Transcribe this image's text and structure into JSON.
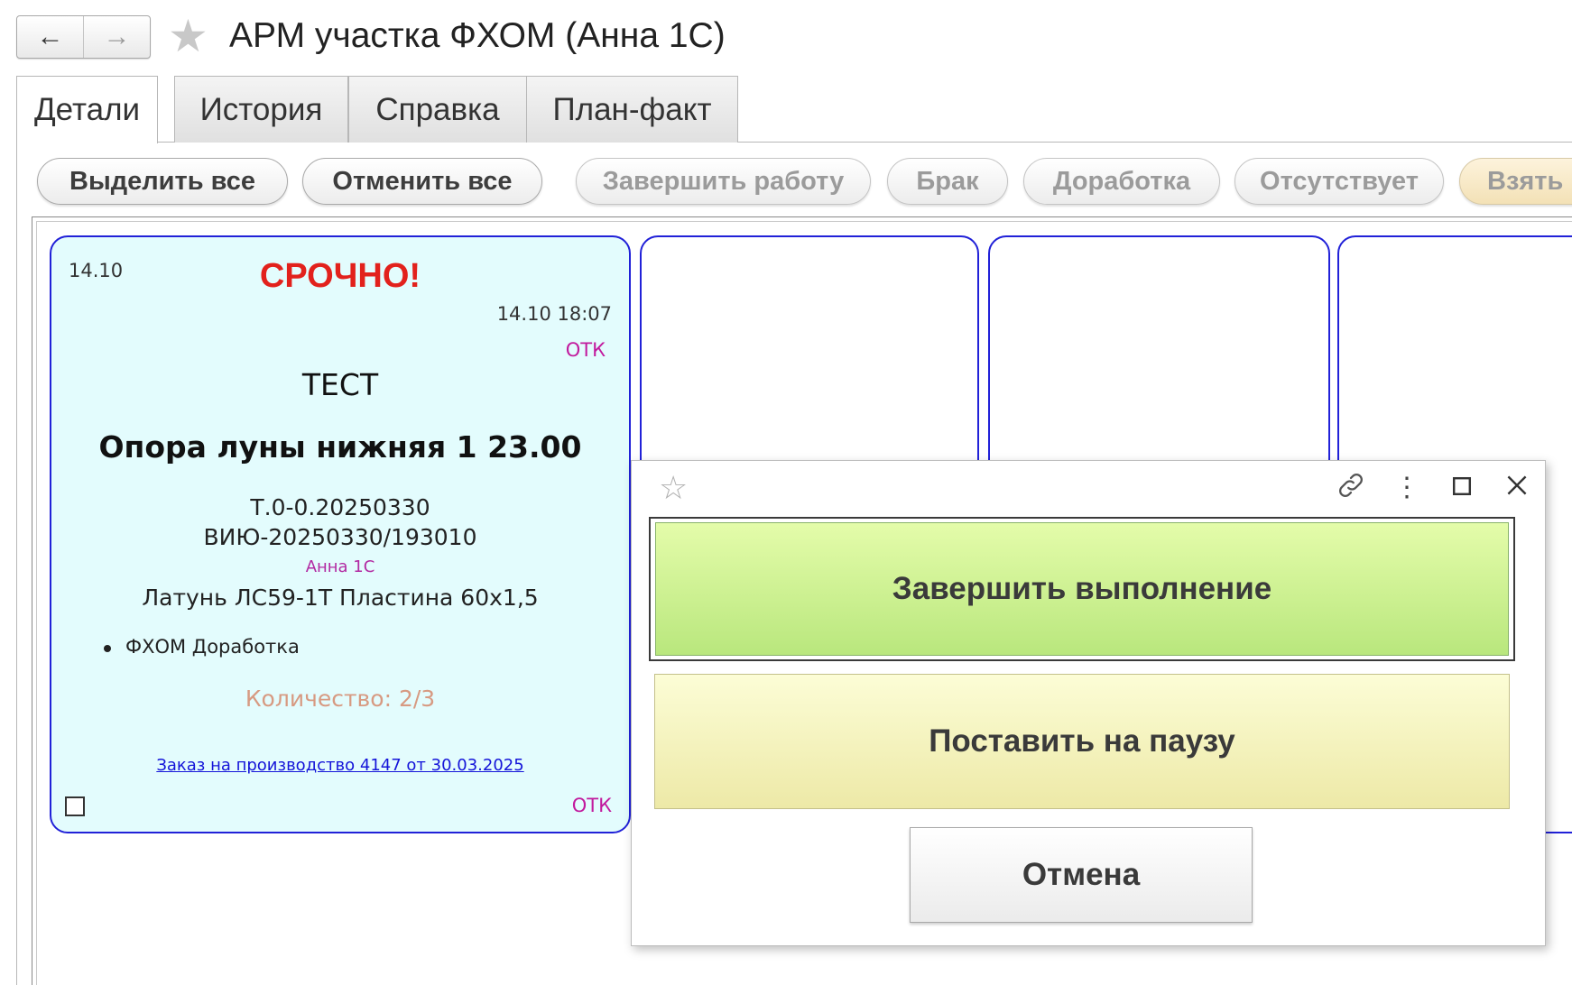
{
  "window": {
    "title": "АРМ участка ФХОМ (Анна 1С)",
    "back_icon": "arrow-left-icon",
    "forward_icon": "arrow-right-icon",
    "favorite_icon": "star-icon"
  },
  "tabs": [
    {
      "label": "Детали",
      "active": true
    },
    {
      "label": "История",
      "active": false
    },
    {
      "label": "Справка",
      "active": false
    },
    {
      "label": "План-факт",
      "active": false
    }
  ],
  "toolbar": {
    "select_all": "Выделить все",
    "deselect_all": "Отменить все",
    "finish_work": "Завершить работу",
    "defect": "Брак",
    "rework": "Доработка",
    "absent": "Отсутствует",
    "take": "Взять в"
  },
  "card": {
    "date": "14.10",
    "urgent": "СРОЧНО!",
    "datetime": "14.10 18:07",
    "otk_top": "ОТК",
    "title": "ТЕСТ",
    "part_name": "Опора луны нижняя 1 23.00",
    "code1": "Т.0-0.20250330",
    "code2": "ВИЮ-20250330/193010",
    "user": "Анна 1С",
    "material": "Латунь ЛС59-1Т Пластина 60х1,5",
    "operations": [
      "ФХОМ Доработка"
    ],
    "quantity": "Количество: 2/3",
    "order_link": "Заказ на производство 4147 от 30.03.2025",
    "otk_bottom": "ОТК",
    "checked": false
  },
  "modal": {
    "icons": {
      "favorite": "star-outline-icon",
      "link": "link-icon",
      "more": "more-vertical-icon",
      "maximize": "maximize-icon",
      "close": "close-icon"
    },
    "finish_button": "Завершить выполнение",
    "pause_button": "Поставить на паузу",
    "cancel_button": "Отмена"
  },
  "colors": {
    "card_border": "#2121d8",
    "card_bg": "#e3fcfd",
    "urgent": "#e2211c",
    "otk": "#c21a9e",
    "finish_bg": "#c9ef8d",
    "pause_bg": "#f4f2bd"
  }
}
